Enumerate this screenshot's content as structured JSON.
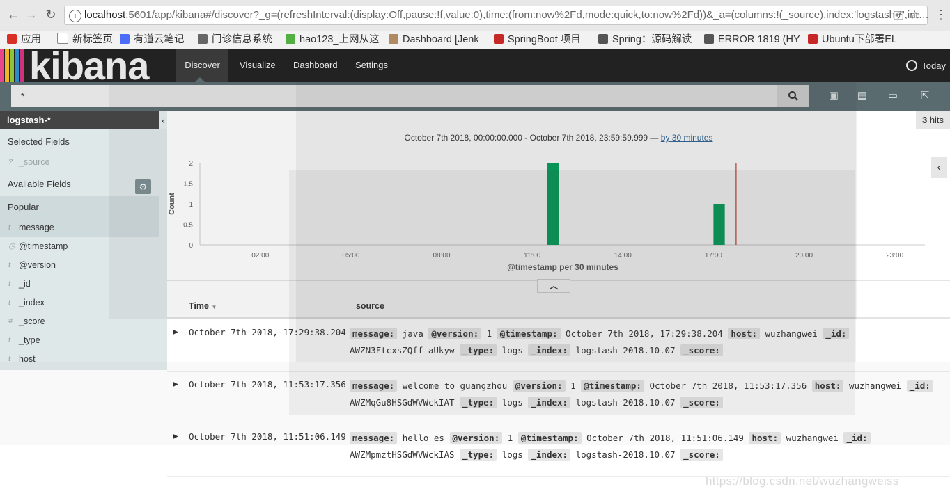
{
  "browser": {
    "url_host": "localhost",
    "url_rest": ":5601/app/kibana#/discover?_g=(refreshInterval:(display:Off,pause:!f,value:0),time:(from:now%2Fd,mode:quick,to:now%2Fd))&_a=(columns:!(_source),index:'logstash-*',int…",
    "bookmarks": [
      {
        "label": "应用",
        "color": "#d93025"
      },
      {
        "label": "新标签页",
        "color": "#ffffff"
      },
      {
        "label": "有道云笔记",
        "color": "#4a6cf7"
      },
      {
        "label": "门诊信息系统",
        "color": "#666666"
      },
      {
        "label": "hao123_上网从这",
        "color": "#52b043"
      },
      {
        "label": "Dashboard [Jenk",
        "color": "#b08a62"
      },
      {
        "label": "SpringBoot 项目",
        "color": "#c62828"
      },
      {
        "label": "Spring：源码解读",
        "color": "#555555"
      },
      {
        "label": "ERROR 1819 (HY",
        "color": "#555555"
      },
      {
        "label": "Ubuntu下部署EL",
        "color": "#c62828"
      }
    ]
  },
  "kibana": {
    "logo_text": "kibana",
    "nav": {
      "discover": "Discover",
      "visualize": "Visualize",
      "dashboard": "Dashboard",
      "settings": "Settings",
      "time_picker": "Today"
    },
    "search": {
      "query": "*"
    }
  },
  "sidebar": {
    "index_pattern": "logstash-*",
    "selected_fields_title": "Selected Fields",
    "selected_fields": [
      {
        "type": "?",
        "name": "_source"
      }
    ],
    "available_fields_title": "Available Fields",
    "popular_title": "Popular",
    "fields": [
      {
        "type": "t",
        "name": "message"
      },
      {
        "type": "◷",
        "name": "@timestamp"
      },
      {
        "type": "t",
        "name": "@version"
      },
      {
        "type": "t",
        "name": "_id"
      },
      {
        "type": "t",
        "name": "_index"
      },
      {
        "type": "#",
        "name": "_score"
      },
      {
        "type": "t",
        "name": "_type"
      },
      {
        "type": "t",
        "name": "host"
      }
    ]
  },
  "main": {
    "hits_count": "3",
    "hits_label": "hits",
    "range_text": "October 7th 2018, 00:00:00.000 - October 7th 2018, 23:59:59.999 — ",
    "interval_link": "by 30 minutes",
    "columns": {
      "time": "Time",
      "source": "_source"
    },
    "documents": [
      {
        "time": "October 7th 2018, 17:29:38.204",
        "message": "java",
        "version": "1",
        "timestamp": "October 7th 2018, 17:29:38.204",
        "host": "wuzhangwei",
        "id": "AWZN3FtcxsZQff_aUkyw",
        "type": "logs",
        "index": "logstash-2018.10.07",
        "score": ""
      },
      {
        "time": "October 7th 2018, 11:53:17.356",
        "message": "welcome to guangzhou",
        "version": "1",
        "timestamp": "October 7th 2018, 11:53:17.356",
        "host": "wuzhangwei",
        "id": "AWZMqGu8HSGdWVWckIAT",
        "type": "logs",
        "index": "logstash-2018.10.07",
        "score": ""
      },
      {
        "time": "October 7th 2018, 11:51:06.149",
        "message": "hello es",
        "version": "1",
        "timestamp": "October 7th 2018, 11:51:06.149",
        "host": "wuzhangwei",
        "id": "AWZMpmztHSGdWVWckIAS",
        "type": "logs",
        "index": "logstash-2018.10.07",
        "score": ""
      }
    ],
    "source_keys": {
      "message": "message:",
      "version": "@version:",
      "timestamp": "@timestamp:",
      "host": "host:",
      "id": "_id:",
      "type": "_type:",
      "index": "_index:",
      "score": "_score:"
    }
  },
  "watermark": "https://blog.csdn.net/wuzhangweiss",
  "chart_data": {
    "type": "bar",
    "title": "",
    "xlabel": "@timestamp per 30 minutes",
    "ylabel": "Count",
    "x_ticks": [
      "02:00",
      "05:00",
      "08:00",
      "11:00",
      "14:00",
      "17:00",
      "20:00",
      "23:00"
    ],
    "y_ticks": [
      "0",
      "0.5",
      "1",
      "1.5",
      "2"
    ],
    "ylim": [
      0,
      2
    ],
    "xlim_hours": [
      0,
      24
    ],
    "bars": [
      {
        "bucket_start": "11:30",
        "hours": 11.5,
        "value": 2
      },
      {
        "bucket_start": "17:00",
        "hours": 17.0,
        "value": 1
      }
    ],
    "current_time_marker_hours": 17.75,
    "bar_color": "#00a05a",
    "marker_color": "#c0392b",
    "grid": false,
    "legend": "none"
  }
}
